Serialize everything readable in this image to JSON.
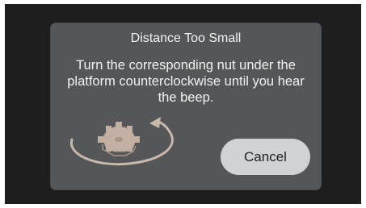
{
  "dialog": {
    "title": "Distance Too Small",
    "message": "Turn the corresponding nut under the platform counterclockwise until you hear the beep.",
    "cancel_label": "Cancel",
    "illustration_icon": "nut-rotate-counterclockwise-icon"
  },
  "colors": {
    "screen_background": "#1e1e1e",
    "dialog_background": "#555657",
    "text": "#f2f2f2",
    "button_background": "#d1d2d4",
    "illustration": "#c9b8ad"
  }
}
